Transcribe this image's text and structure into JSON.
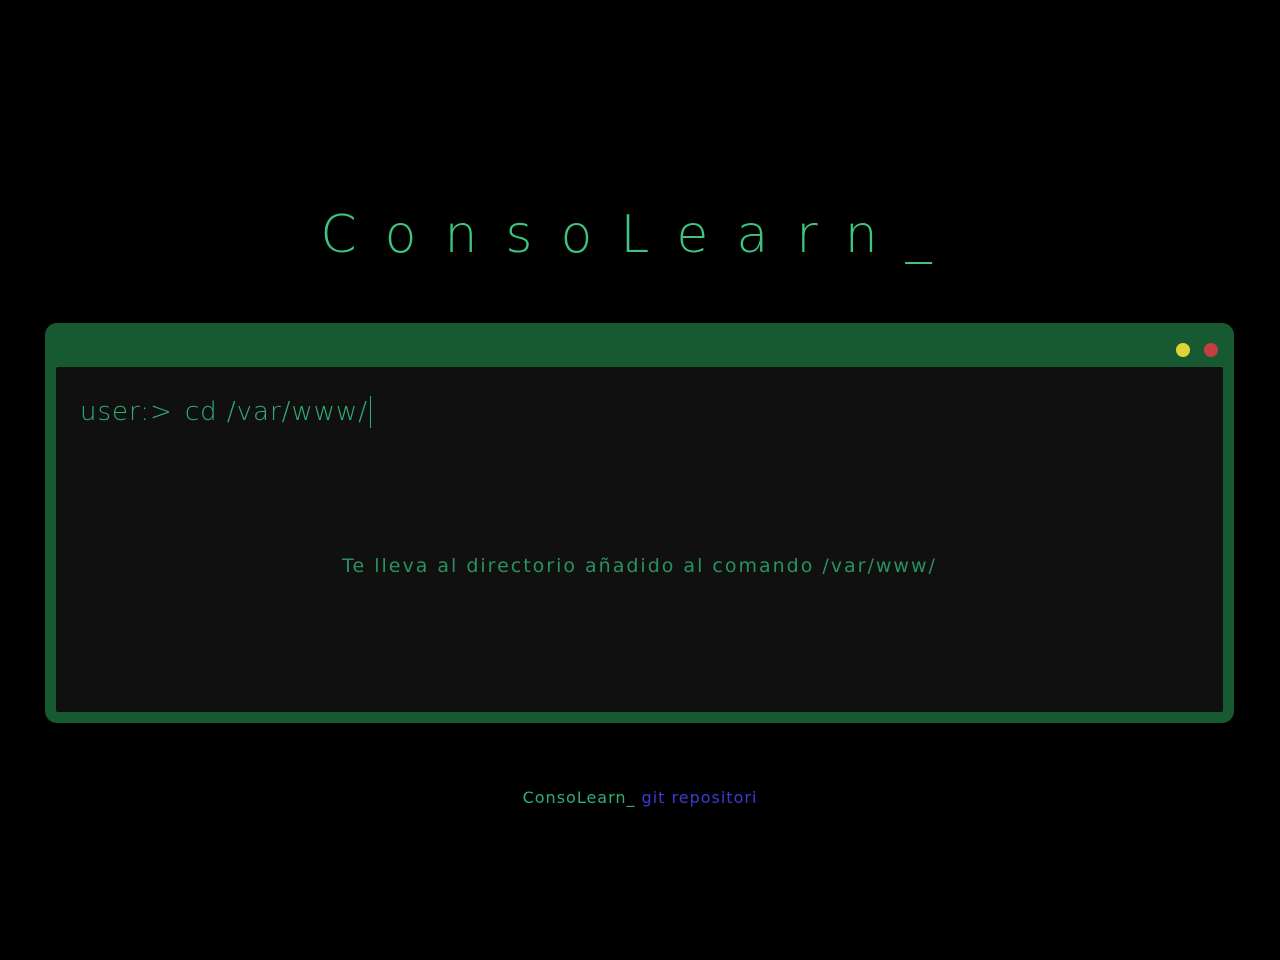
{
  "header": {
    "title": "ConsoLearn_"
  },
  "terminal": {
    "prompt": "user:>",
    "command": "cd /var/www/",
    "description": "Te lleva al directorio añadido al comando /var/www/",
    "window_controls": [
      {
        "name": "minimize",
        "color": "#e0d33a"
      },
      {
        "name": "close",
        "color": "#c43f3f"
      }
    ]
  },
  "footer": {
    "brand": "ConsoLearn_",
    "link_label": "git repositori"
  },
  "colors": {
    "accent": "#3ec47f",
    "frame": "#175a32",
    "screen": "#111011",
    "link": "#3b3bd4"
  }
}
